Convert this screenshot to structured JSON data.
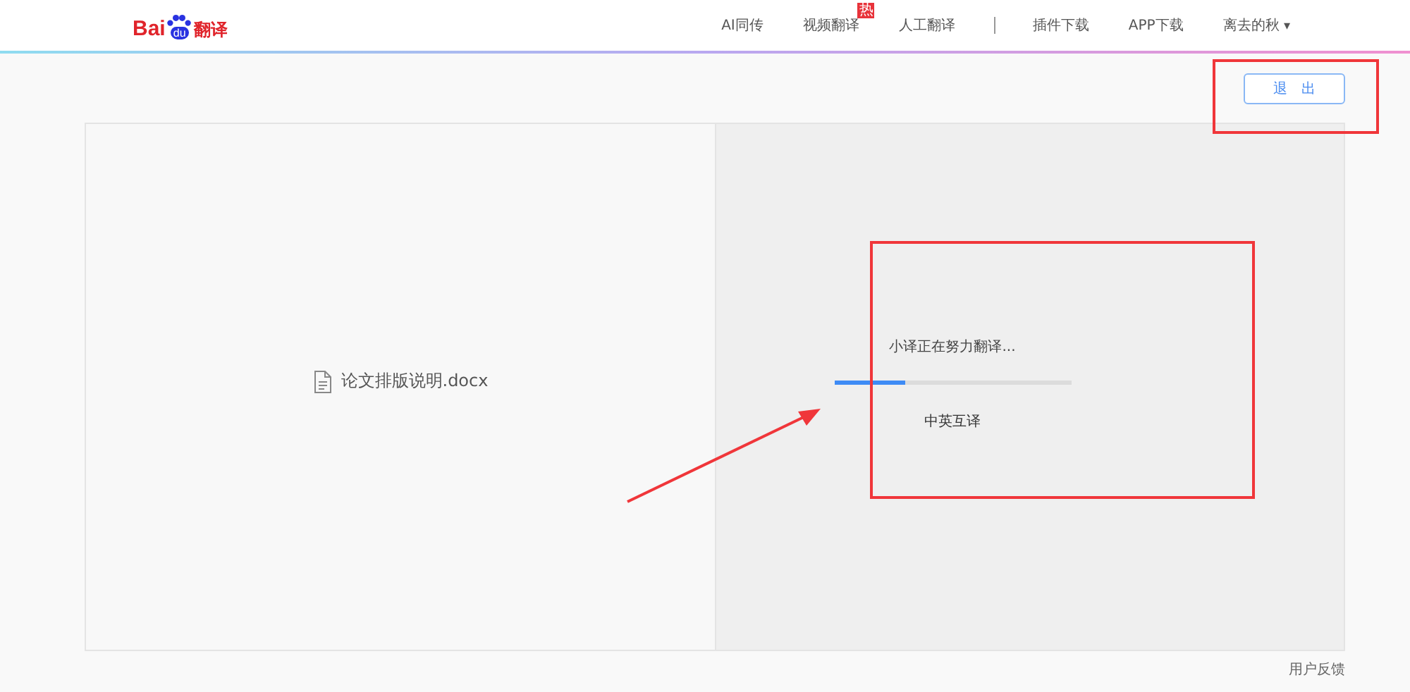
{
  "header": {
    "logo": {
      "left": "Bai",
      "paw": "du",
      "right": "翻译"
    },
    "nav": [
      {
        "label": "AI同传"
      },
      {
        "label": "视频翻译",
        "badge": "热"
      },
      {
        "label": "人工翻译"
      },
      {
        "label": "插件下载",
        "divider_before": true
      },
      {
        "label": "APP下载"
      }
    ],
    "user": {
      "name": "离去的秋",
      "dropdown": "▾"
    }
  },
  "exit_button": {
    "label": "退　出",
    "highlighted": true
  },
  "document": {
    "file_name": "论文排版说明.docx"
  },
  "translation": {
    "status": "小译正在努力翻译...",
    "level": 0.3,
    "language": "中英互译",
    "highlighted": true,
    "arrow": true
  },
  "feedback": "用户反馈"
}
